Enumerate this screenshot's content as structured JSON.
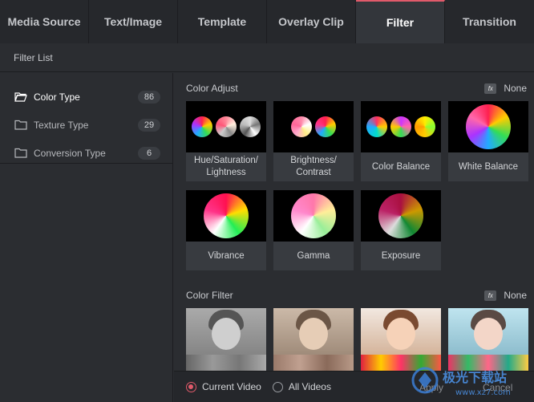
{
  "tabs": [
    "Media Source",
    "Text/Image",
    "Template",
    "Overlay Clip",
    "Filter",
    "Transition"
  ],
  "active_tab": "Filter",
  "filter_list_title": "Filter List",
  "sidebar": {
    "items": [
      {
        "label": "Color Type",
        "count": "86",
        "icon": "folder-open-icon"
      },
      {
        "label": "Texture Type",
        "count": "29",
        "icon": "folder-icon"
      },
      {
        "label": "Conversion Type",
        "count": "6",
        "icon": "folder-icon"
      }
    ]
  },
  "color_adjust": {
    "title": "Color Adjust",
    "badge": "fx",
    "none_label": "None",
    "cards": [
      "Hue/Saturation/\nLightness",
      "Brightness/\nContrast",
      "Color Balance",
      "White Balance",
      "Vibrance",
      "Gamma",
      "Exposure"
    ]
  },
  "color_filter": {
    "title": "Color Filter",
    "badge": "fx",
    "none_label": "None"
  },
  "footer": {
    "radio_current": "Current Video",
    "radio_all": "All Videos",
    "apply_label": "Apply",
    "cancel_label": "Cancel"
  },
  "watermark": {
    "text_cn": "极光下载站",
    "text_url": "www.xz7.com"
  },
  "colors": {
    "accent": "#e05a6a",
    "background": "#2b2d31",
    "tab_active": "#33363b"
  }
}
